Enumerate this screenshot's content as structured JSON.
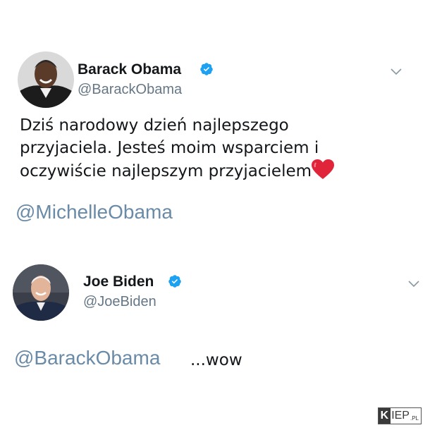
{
  "tweets": [
    {
      "display_name": "Barack Obama",
      "handle": "@BarackObama",
      "avatar_icon": "barack-obama-avatar",
      "verified_icon": "verified-badge-icon",
      "menu_icon": "chevron-down-icon",
      "text_lines": [
        "Dziś narodowy dzień najlepszego",
        "przyjaciela. Jesteś moim wsparciem i",
        "oczywiście najlepszym przyjacielem"
      ],
      "text_emoji": "heart-emoji",
      "mention": "@MichelleObama"
    },
    {
      "display_name": "Joe Biden",
      "handle": "@JoeBiden",
      "avatar_icon": "joe-biden-avatar",
      "verified_icon": "verified-badge-icon",
      "menu_icon": "chevron-down-icon",
      "mention": "@BarackObama",
      "suffix_text": "...wow"
    }
  ],
  "watermark": {
    "letter": "K",
    "rest": "IEP",
    "suffix": ".PL"
  },
  "colors": {
    "text": "#14171a",
    "handle": "#657786",
    "mention": "#6a8ba8",
    "verified": "#1da1f2",
    "heart": "#e0243a"
  }
}
